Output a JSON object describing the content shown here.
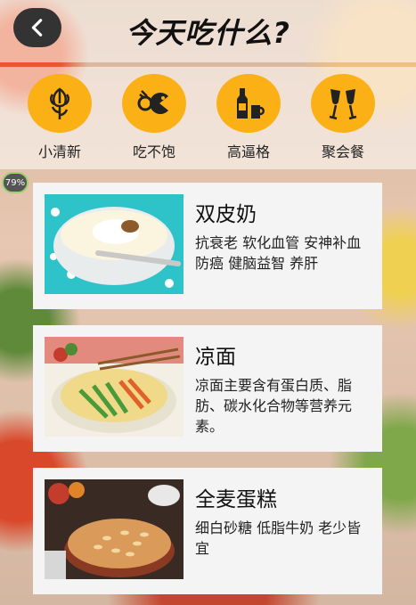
{
  "header": {
    "title": "今天吃什么?"
  },
  "battery": "79%",
  "categories": [
    {
      "label": "小清新",
      "icon": "flower-icon"
    },
    {
      "label": "吃不饱",
      "icon": "eating-mouth-icon"
    },
    {
      "label": "高逼格",
      "icon": "bottle-cup-icon"
    },
    {
      "label": "聚会餐",
      "icon": "cheers-glasses-icon"
    }
  ],
  "foods": [
    {
      "name": "双皮奶",
      "desc": "抗衰老 软化血管 安神补血 防癌 健脑益智 养肝"
    },
    {
      "name": "凉面",
      "desc": "凉面主要含有蛋白质、脂肪、碳水化合物等营养元素。"
    },
    {
      "name": "全麦蛋糕",
      "desc": "细白砂糖 低脂牛奶 老少皆宜"
    }
  ],
  "colors": {
    "accent": "#fbb016",
    "card_bg": "#f4f4f4",
    "back_button": "#333333"
  }
}
